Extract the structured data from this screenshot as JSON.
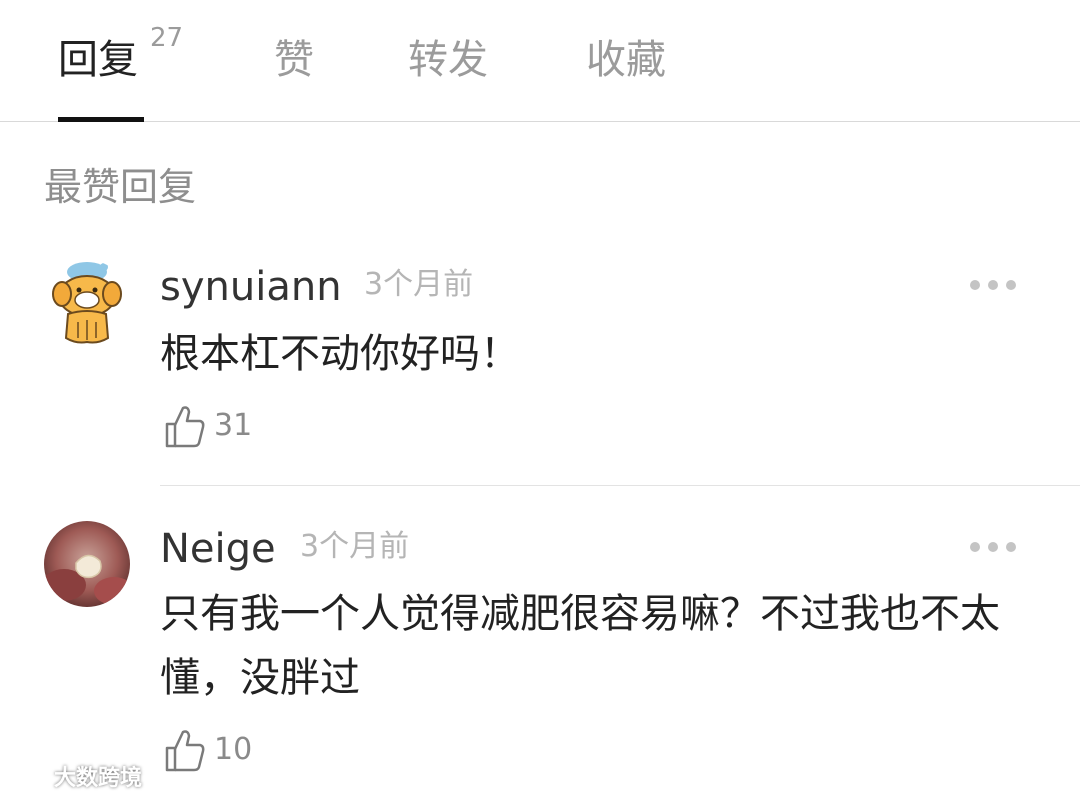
{
  "tabs": [
    {
      "label": "回复",
      "count": "27",
      "active": true
    },
    {
      "label": "赞"
    },
    {
      "label": "转发"
    },
    {
      "label": "收藏"
    }
  ],
  "section_title": "最赞回复",
  "comments": [
    {
      "username": "synuiann",
      "time": "3个月前",
      "text": "根本杠不动你好吗！",
      "likes": "31",
      "avatar_icon": "cartoon-dog-avatar"
    },
    {
      "username": "Neige",
      "time": "3个月前",
      "text": "只有我一个人觉得减肥很容易嘛？不过我也不太懂，没胖过",
      "likes": "10",
      "avatar_icon": "photo-avatar"
    }
  ],
  "watermark": "大数跨境",
  "colors": {
    "active_tab": "#222222",
    "inactive_tab": "#9b9b9b",
    "meta": "#b5b5b5",
    "underline": "#111111"
  }
}
